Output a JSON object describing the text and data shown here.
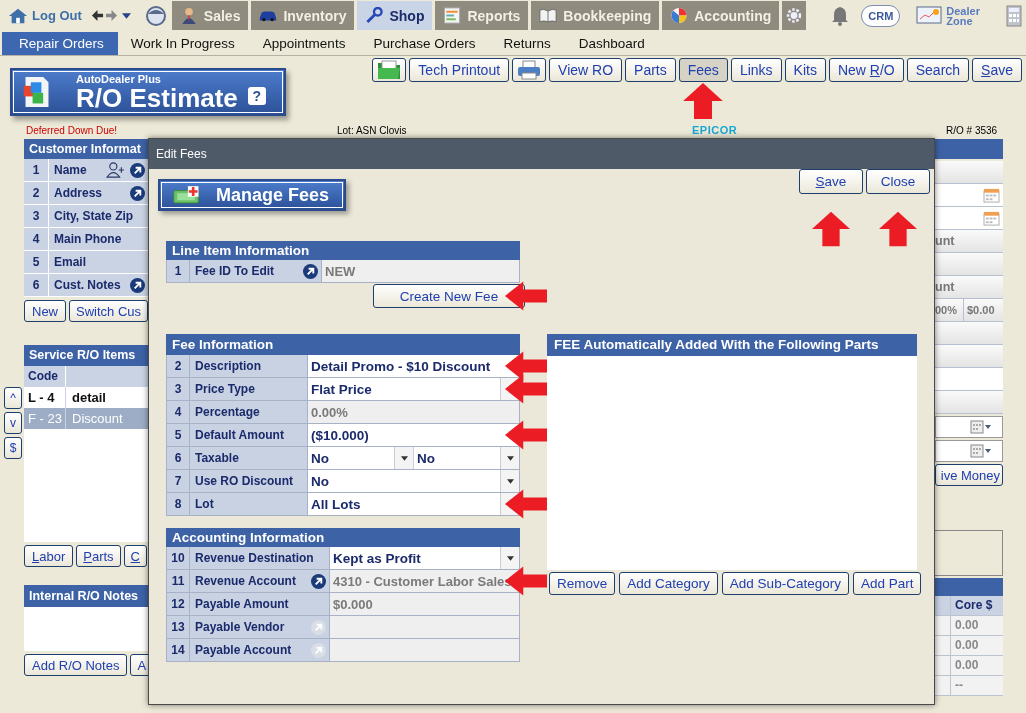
{
  "nav": {
    "logout": "Log Out",
    "tabs": [
      {
        "label": "Sales",
        "selected": false
      },
      {
        "label": "Inventory",
        "selected": false
      },
      {
        "label": "Shop",
        "selected": true
      },
      {
        "label": "Reports",
        "selected": false
      },
      {
        "label": "Bookkeeping",
        "selected": false
      },
      {
        "label": "Accounting",
        "selected": false
      }
    ],
    "crm": "CRM",
    "dealer_zone": "Dealer Zone"
  },
  "subnav": [
    {
      "label": "Repair Orders",
      "selected": true
    },
    {
      "label": "Work In Progress",
      "selected": false
    },
    {
      "label": "Appointments",
      "selected": false
    },
    {
      "label": "Purchase Orders",
      "selected": false
    },
    {
      "label": "Returns",
      "selected": false
    },
    {
      "label": "Dashboard",
      "selected": false
    }
  ],
  "logo": {
    "brand": "AutoDealer Plus",
    "title": "R/O Estimate",
    "help": "?"
  },
  "toolbar": [
    {
      "kind": "icon",
      "pressed": false
    },
    {
      "kind": "text",
      "label": "Tech Printout",
      "pressed": false
    },
    {
      "kind": "icon",
      "pressed": false
    },
    {
      "kind": "text",
      "label": "View RO",
      "pressed": false
    },
    {
      "kind": "text",
      "label": "Parts",
      "pressed": false
    },
    {
      "kind": "text",
      "label": "Fees",
      "pressed": true,
      "callout": true
    },
    {
      "kind": "text",
      "label": "Links",
      "pressed": false
    },
    {
      "kind": "text",
      "label": "Kits",
      "pressed": false
    },
    {
      "kind": "key",
      "before": "New ",
      "key": "R",
      "after": "/O",
      "pressed": false
    },
    {
      "kind": "text",
      "label": "Search",
      "pressed": false
    },
    {
      "kind": "key",
      "key": "S",
      "after": "ave",
      "pressed": false
    }
  ],
  "info": {
    "alert": "Deferred Down Due!",
    "lot": "Lot: ASN Clovis",
    "vendor": "EPICOR",
    "ro_number": "R/O # 3536"
  },
  "customer": {
    "title": "Customer Informat",
    "rows": [
      {
        "num": "1",
        "label": "Name",
        "add_person": true,
        "lookup": true
      },
      {
        "num": "2",
        "label": "Address",
        "lookup": true
      },
      {
        "num": "3",
        "label": "City, State Zip"
      },
      {
        "num": "4",
        "label": "Main Phone"
      },
      {
        "num": "5",
        "label": "Email"
      },
      {
        "num": "6",
        "label": "Cust. Notes",
        "lookup": true
      }
    ],
    "buttons": [
      "New",
      "Switch Cus"
    ]
  },
  "service": {
    "title": "Service R/O Items",
    "column": "Code",
    "rows": [
      {
        "code": "L - 4",
        "description": "detail",
        "selected": false
      },
      {
        "code": "F - 23",
        "description": "Discount",
        "selected": true
      }
    ],
    "side_buttons": [
      "^",
      "v",
      "$"
    ],
    "buttons": [
      {
        "key": "L",
        "after": "abor"
      },
      {
        "key": "P",
        "after": "arts"
      },
      {
        "key": "C"
      }
    ]
  },
  "notes": {
    "title": "Internal R/O Notes",
    "buttons": [
      "Add R/O Notes",
      "A"
    ]
  },
  "right": {
    "rows": [
      {
        "kind": "blank"
      },
      {
        "kind": "date"
      },
      {
        "kind": "date"
      },
      {
        "kind": "text",
        "text": "unt"
      },
      {
        "kind": "blank"
      },
      {
        "kind": "text",
        "text": "unt"
      },
      {
        "kind": "pair",
        "texts": [
          "00%",
          "$0.00"
        ]
      },
      {
        "kind": "blank"
      },
      {
        "kind": "blank"
      },
      {
        "kind": "white"
      },
      {
        "kind": "blank"
      }
    ],
    "pickers": [
      {
        "kind": "picker"
      },
      {
        "kind": "picker"
      }
    ],
    "button": "ive Money",
    "parts_column": "Core $",
    "parts_values": [
      "0.00",
      "0.00",
      "0.00",
      "--"
    ]
  },
  "modal": {
    "title": "Edit Fees",
    "banner": "Manage Fees",
    "buttons": [
      {
        "key": "S",
        "after": "ave",
        "callout": true
      },
      {
        "label": "Close",
        "callout": true
      }
    ],
    "sections": [
      {
        "title": "Line Item Information",
        "rows": [
          {
            "num": "1",
            "label": "Fee ID To Edit",
            "kind": "readonly",
            "value": "NEW",
            "lookup": true,
            "lookup_disabled": false
          }
        ]
      },
      {
        "title": "Fee Information",
        "rows": [
          {
            "num": "2",
            "label": "Description",
            "kind": "text",
            "value": "Detail Promo - $10 Discount",
            "callout": true
          },
          {
            "num": "3",
            "label": "Price Type",
            "kind": "select",
            "value": "Flat Price",
            "callout": true
          },
          {
            "num": "4",
            "label": "Percentage",
            "kind": "readonly",
            "value": "0.00%"
          },
          {
            "num": "5",
            "label": "Default Amount",
            "kind": "text",
            "value": "($10.000)",
            "callout": true
          },
          {
            "num": "6",
            "label": "Taxable",
            "kind": "double",
            "values": [
              "No",
              "No"
            ]
          },
          {
            "num": "7",
            "label": "Use RO Discount",
            "kind": "select",
            "value": "No"
          },
          {
            "num": "8",
            "label": "Lot",
            "kind": "select",
            "value": "All Lots",
            "callout": true
          }
        ]
      },
      {
        "title": "Accounting Information",
        "rows": [
          {
            "num": "10",
            "label": "Revenue Destination",
            "kind": "select",
            "value": "Kept as Profit"
          },
          {
            "num": "11",
            "label": "Revenue Account",
            "kind": "readonly",
            "value": "4310 - Customer Labor Sales",
            "lookup": true,
            "lookup_disabled": false,
            "callout": true
          },
          {
            "num": "12",
            "label": "Payable Amount",
            "kind": "readonly",
            "value": "$0.000"
          },
          {
            "num": "13",
            "label": "Payable Vendor",
            "kind": "readonly",
            "lookup": true,
            "lookup_disabled": true
          },
          {
            "num": "14",
            "label": "Payable Account",
            "kind": "readonly",
            "lookup": true,
            "lookup_disabled": true
          }
        ]
      }
    ],
    "create_button": {
      "label": "Create New Fee",
      "callout": true
    },
    "parts_panel": {
      "title": "FEE Automatically Added With the Following Parts",
      "buttons": [
        "Remove",
        "Add Category",
        "Add Sub-Category",
        "Add Part"
      ]
    }
  }
}
